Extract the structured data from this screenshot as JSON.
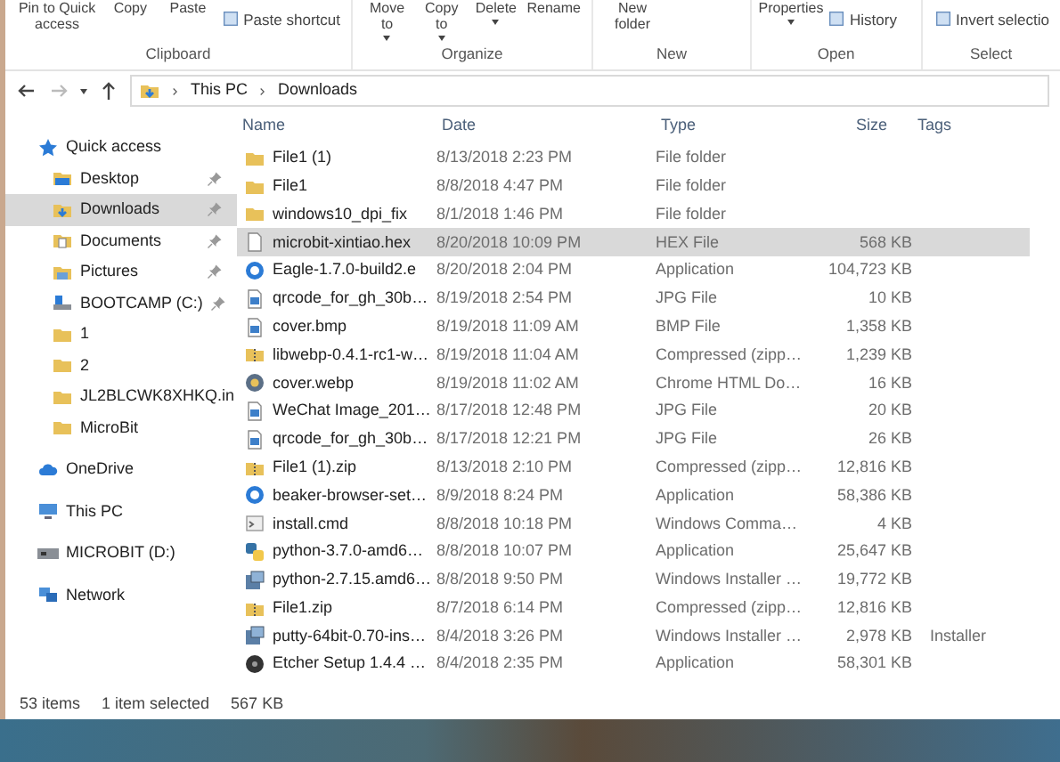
{
  "ribbon": {
    "groups": [
      {
        "label": "Clipboard",
        "commands": [
          {
            "label": "Pin to Quick access",
            "kind": "large",
            "dropdown": false
          },
          {
            "label": "Copy",
            "kind": "large",
            "dropdown": false
          },
          {
            "label": "Paste",
            "kind": "large",
            "dropdown": false
          },
          {
            "label": "Paste shortcut",
            "kind": "small",
            "dropdown": false
          }
        ]
      },
      {
        "label": "Organize",
        "commands": [
          {
            "label": "Move to",
            "kind": "large",
            "dropdown": true
          },
          {
            "label": "Copy to",
            "kind": "large",
            "dropdown": true
          },
          {
            "label": "Delete",
            "kind": "large",
            "dropdown": true
          },
          {
            "label": "Rename",
            "kind": "large",
            "dropdown": false
          }
        ]
      },
      {
        "label": "New",
        "commands": [
          {
            "label": "New folder",
            "kind": "large",
            "dropdown": false
          }
        ]
      },
      {
        "label": "Open",
        "commands": [
          {
            "label": "Properties",
            "kind": "large",
            "dropdown": true
          },
          {
            "label": "History",
            "kind": "small",
            "dropdown": false
          }
        ]
      },
      {
        "label": "Select",
        "commands": [
          {
            "label": "Invert selectio",
            "kind": "small",
            "dropdown": false
          }
        ]
      }
    ]
  },
  "address": {
    "back_enabled": true,
    "forward_enabled": false,
    "path": [
      "This PC",
      "Downloads"
    ]
  },
  "sidebar": {
    "items": [
      {
        "label": "Quick access",
        "kind": "star",
        "pinned": false,
        "selected": false,
        "children": [
          {
            "label": "Desktop",
            "kind": "desktop",
            "pinned": true,
            "selected": false
          },
          {
            "label": "Downloads",
            "kind": "downloads",
            "pinned": true,
            "selected": true
          },
          {
            "label": "Documents",
            "kind": "documents",
            "pinned": true,
            "selected": false
          },
          {
            "label": "Pictures",
            "kind": "pictures",
            "pinned": true,
            "selected": false
          },
          {
            "label": "BOOTCAMP (C:)",
            "kind": "drive",
            "pinned": true,
            "selected": false
          },
          {
            "label": "1",
            "kind": "folder",
            "pinned": false,
            "selected": false
          },
          {
            "label": "2",
            "kind": "folder",
            "pinned": false,
            "selected": false
          },
          {
            "label": "JL2BLCWK8XHKQ.in",
            "kind": "folder",
            "pinned": false,
            "selected": false
          },
          {
            "label": "MicroBit",
            "kind": "folder",
            "pinned": false,
            "selected": false
          }
        ]
      },
      {
        "label": "OneDrive",
        "kind": "cloud",
        "pinned": false,
        "selected": false
      },
      {
        "label": "This PC",
        "kind": "pc",
        "pinned": false,
        "selected": false
      },
      {
        "label": "MICROBIT (D:)",
        "kind": "usb",
        "pinned": false,
        "selected": false
      },
      {
        "label": "Network",
        "kind": "network",
        "pinned": false,
        "selected": false
      }
    ]
  },
  "table": {
    "columns": [
      "Name",
      "Date",
      "Type",
      "Size",
      "Tags"
    ],
    "rows": [
      {
        "kind": "folder",
        "name": "File1 (1)",
        "date": "8/13/2018 2:23 PM",
        "type": "File folder",
        "selected": false
      },
      {
        "kind": "folder",
        "name": "File1",
        "date": "8/8/2018 4:47 PM",
        "type": "File folder",
        "selected": false
      },
      {
        "kind": "folder",
        "name": "windows10_dpi_fix",
        "date": "8/1/2018 1:46 PM",
        "type": "File folder",
        "selected": false
      },
      {
        "kind": "document",
        "name": "microbit-xintiao.hex",
        "date": "8/20/2018 10:09 PM",
        "type": "HEX File",
        "size": "568 KB",
        "selected": true
      },
      {
        "kind": "app",
        "name": "Eagle-1.7.0-build2.e",
        "date": "8/20/2018 2:04 PM",
        "type": "Application",
        "size": "104,723 KB",
        "selected": false
      },
      {
        "kind": "image",
        "name": "qrcode_for_gh_30b…",
        "date": "8/19/2018 2:54 PM",
        "type": "JPG File",
        "size": "10 KB",
        "selected": false
      },
      {
        "kind": "image",
        "name": "cover.bmp",
        "date": "8/19/2018 11:09 AM",
        "type": "BMP File",
        "size": "1,358 KB",
        "selected": false
      },
      {
        "kind": "zip",
        "name": "libwebp-0.4.1-rc1-w…",
        "date": "8/19/2018 11:04 AM",
        "type": "Compressed (zipp…",
        "size": "1,239 KB",
        "selected": false
      },
      {
        "kind": "browser",
        "name": "cover.webp",
        "date": "8/19/2018 11:02 AM",
        "type": "Chrome HTML Do…",
        "size": "16 KB",
        "selected": false
      },
      {
        "kind": "image",
        "name": "WeChat Image_201…",
        "date": "8/17/2018 12:48 PM",
        "type": "JPG File",
        "size": "20 KB",
        "selected": false
      },
      {
        "kind": "image",
        "name": "qrcode_for_gh_30b…",
        "date": "8/17/2018 12:21 PM",
        "type": "JPG File",
        "size": "26 KB",
        "selected": false
      },
      {
        "kind": "zip",
        "name": "File1 (1).zip",
        "date": "8/13/2018 2:10 PM",
        "type": "Compressed (zipp…",
        "size": "12,816 KB",
        "selected": false
      },
      {
        "kind": "app",
        "name": "beaker-browser-set…",
        "date": "8/9/2018 8:24 PM",
        "type": "Application",
        "size": "58,386 KB",
        "selected": false
      },
      {
        "kind": "script",
        "name": "install.cmd",
        "date": "8/8/2018 10:18 PM",
        "type": "Windows Comma…",
        "size": "4 KB",
        "selected": false
      },
      {
        "kind": "python",
        "name": "python-3.7.0-amd6…",
        "date": "8/8/2018 10:07 PM",
        "type": "Application",
        "size": "25,647 KB",
        "selected": false
      },
      {
        "kind": "installer",
        "name": "python-2.7.15.amd6…",
        "date": "8/8/2018 9:50 PM",
        "type": "Windows Installer …",
        "size": "19,772 KB",
        "selected": false
      },
      {
        "kind": "zip",
        "name": "File1.zip",
        "date": "8/7/2018 6:14 PM",
        "type": "Compressed (zipp…",
        "size": "12,816 KB",
        "selected": false
      },
      {
        "kind": "installer",
        "name": "putty-64bit-0.70-ins…",
        "date": "8/4/2018 3:26 PM",
        "type": "Windows Installer …",
        "size": "2,978 KB",
        "tags": "Installer",
        "selected": false
      },
      {
        "kind": "disc",
        "name": "Etcher Setup 1.4.4 …",
        "date": "8/4/2018 2:35 PM",
        "type": "Application",
        "size": "58,301 KB",
        "selected": false
      }
    ]
  },
  "status_bar": {
    "count": "53 items",
    "selection": "1 item selected",
    "size": "567 KB"
  }
}
